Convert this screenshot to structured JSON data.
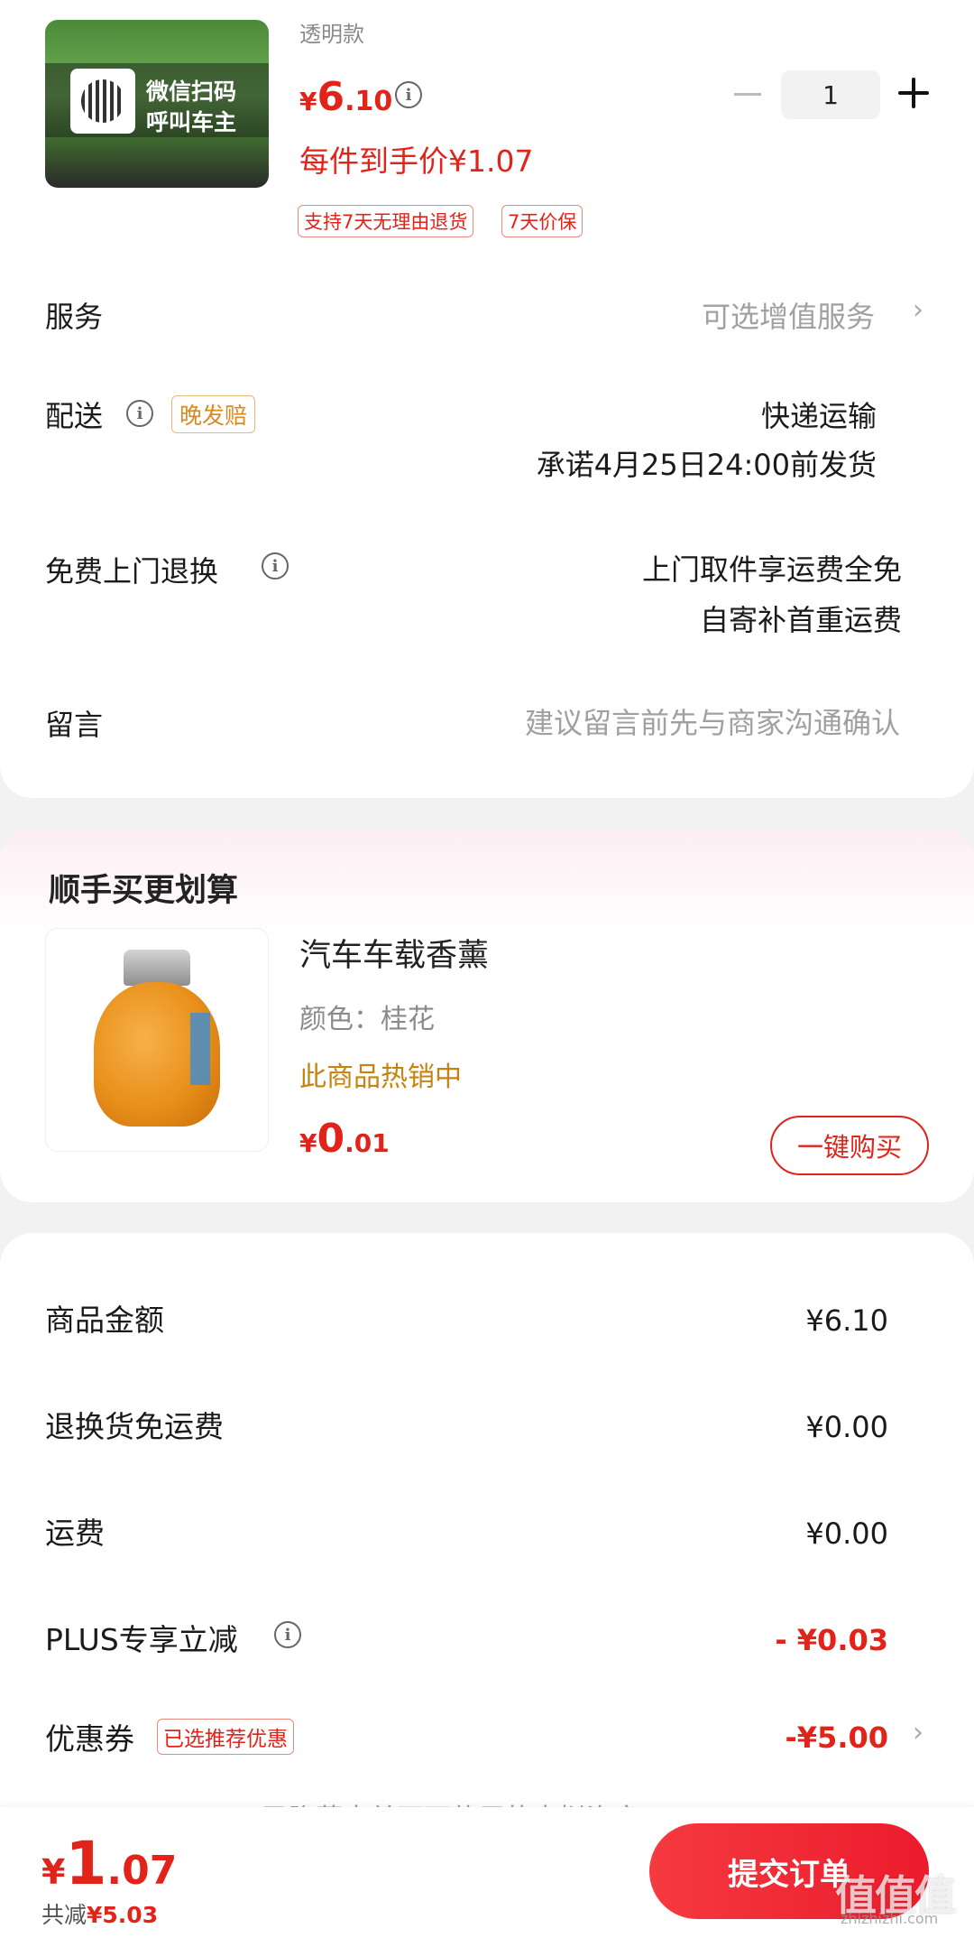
{
  "product": {
    "thumb_line1": "微信扫码",
    "thumb_line2": "呼叫车主",
    "variant": "透明款",
    "price_currency": "¥",
    "price_int": "6",
    "price_dec": ".10",
    "unit_price": "每件到手价¥1.07",
    "tags": [
      "支持7天无理由退货",
      "7天价保"
    ],
    "quantity": "1"
  },
  "service": {
    "label": "服务",
    "value": "可选增值服务",
    "chevron": "›"
  },
  "delivery": {
    "label": "配送",
    "badge": "晚发赔",
    "method": "快递运输",
    "promise": "承诺4月25日24:00前发货"
  },
  "return_service": {
    "label": "免费上门退换",
    "line1": "上门取件享运费全免",
    "line2": "自寄补首重运费"
  },
  "message": {
    "label": "留言",
    "placeholder": "建议留言前先与商家沟通确认"
  },
  "upsell": {
    "title": "顺手买更划算",
    "name": "汽车车载香薰",
    "color": "颜色：桂花",
    "hot": "此商品热销中",
    "price_currency": "¥",
    "price_int": "0",
    "price_dec": ".01",
    "buy_label": "一键购买"
  },
  "summary": {
    "rows": [
      {
        "label": "商品金额",
        "value": "¥6.10"
      },
      {
        "label": "退换货免运费",
        "value": "¥0.00"
      },
      {
        "label": "运费",
        "value": "¥0.00"
      },
      {
        "label": "PLUS专享立减",
        "value": "- ¥0.03"
      },
      {
        "label": "优惠券",
        "badge": "已选推荐优惠",
        "value": "-¥5.00"
      }
    ],
    "partial_line": "已隐藏本单不可使用的虚拟资产"
  },
  "bottom": {
    "currency": "¥",
    "total_int": "1",
    "total_dec": ".07",
    "saved_prefix": "共减",
    "saved_amount": "¥5.03",
    "submit_label": "提交订单"
  },
  "watermark": {
    "main": "值值值",
    "sub": "zhizhizhi.com"
  },
  "colors": {
    "accent": "#e2231a",
    "orange_tag": "#d98a1e",
    "background": "#f2f2f2"
  }
}
